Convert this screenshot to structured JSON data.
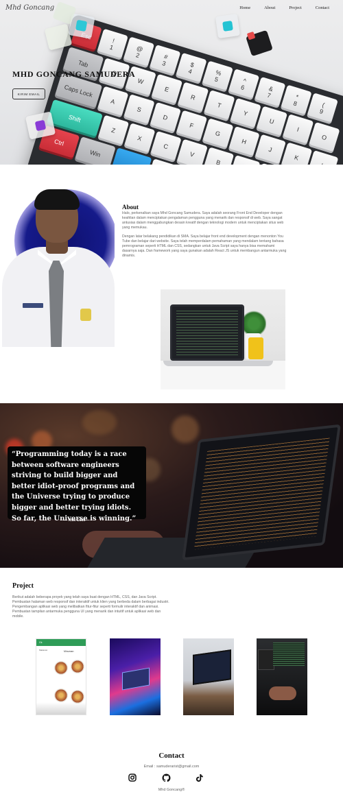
{
  "header": {
    "brand": "Mhd Goncang",
    "nav": [
      "Home",
      "About",
      "Project",
      "Contact"
    ]
  },
  "hero": {
    "title": "MHD GONCANG SAMUDERA",
    "button_label": "KIRIM EMAIL"
  },
  "keyboard": {
    "rows": [
      [
        {
          "t": "Esc",
          "c": "red"
        },
        {
          "t": "!",
          "s": "1"
        },
        {
          "t": "@",
          "s": "2"
        },
        {
          "t": "#",
          "s": "3"
        },
        {
          "t": "$",
          "s": "4"
        },
        {
          "t": "%",
          "s": "5"
        },
        {
          "t": "^",
          "s": "6"
        },
        {
          "t": "&",
          "s": "7"
        },
        {
          "t": "*",
          "s": "8"
        },
        {
          "t": "(",
          "s": "9"
        }
      ],
      [
        {
          "t": "Tab",
          "c": "gray",
          "w": "w18"
        },
        {
          "t": "Q"
        },
        {
          "t": "W"
        },
        {
          "t": "E"
        },
        {
          "t": "R"
        },
        {
          "t": "T"
        },
        {
          "t": "Y"
        },
        {
          "t": "U"
        },
        {
          "t": "I"
        },
        {
          "t": "O"
        }
      ],
      [
        {
          "t": "Caps Lock",
          "c": "gray",
          "w": "w2"
        },
        {
          "t": "A"
        },
        {
          "t": "S"
        },
        {
          "t": "D"
        },
        {
          "t": "F"
        },
        {
          "t": "G"
        },
        {
          "t": "H"
        },
        {
          "t": "J"
        },
        {
          "t": "K"
        },
        {
          "t": "L"
        }
      ],
      [
        {
          "t": "Shift",
          "c": "teal",
          "w": "w25"
        },
        {
          "t": "Z"
        },
        {
          "t": "X"
        },
        {
          "t": "C"
        },
        {
          "t": "V"
        },
        {
          "t": "B"
        },
        {
          "t": "N"
        },
        {
          "t": "M"
        },
        {
          "t": "<"
        },
        {
          "t": ">"
        }
      ],
      [
        {
          "t": "Ctrl",
          "c": "red",
          "w": "w18"
        },
        {
          "t": "Win",
          "c": "gray",
          "w": "w18"
        },
        {
          "t": "",
          "c": "blue",
          "w": "w18"
        },
        {
          "t": ""
        },
        {
          "t": ""
        },
        {
          "t": ""
        },
        {
          "t": ""
        },
        {
          "t": ""
        }
      ]
    ]
  },
  "about": {
    "title": "About",
    "paragraph1": "Halo, perkenalkan saya Mhd Goncang Samudera. Saya adalah seorang Front End Developer dengan keahlian dalam menciptakan pengalaman pengguna yang menarik dan responsif di web. Saya sangat antusias dalam menggabungkan desain kreatif dengan teknologi modern untuk menciptakan situs web yang memukau.",
    "paragraph2": "Dengan latar belakang pendidikan di SMA. Saya belajar front end development dengan menonton You Tube dan belajar dari website. Saya telah memperdalam pemahaman yang mendalam tentang bahasa pemrograman seperti HTML dan CSS, sedangkan untuk Java Script saya hanya bisa memahami dasarnya saja. Dan framework yang saya gunakan adalah React JS untuk membangun antarmuka yang dinamis."
  },
  "quote": {
    "text": "“Programming today is a race between software engineers striving to build bigger and better idiot-proof programs and the Universe trying to produce bigger and better trying idiots. So far, the Universe is winning.”",
    "author": "— Rick Cook —"
  },
  "project": {
    "title": "Project",
    "text": "Berikut adalah beberapa proyek yang telah saya buat dengan HTML, CSS, dan Java Script. Pembuatan halaman web responsif dan interaktif untuk klien yang berbeda dalam berbagai industri. Pengembangan aplikasi web yang melibatkan fitur-fitur seperti formulir interaktif dan animasi. Pembuatan tampilan antarmuka pengguna UI yang menarik dan intuitif untuk aplikasi web dan mobile.",
    "card1": {
      "header": "Gk",
      "section_left": "Makanan",
      "section_right": "Minuman"
    }
  },
  "contact": {
    "title": "Contact",
    "email": "Email : samuderarist@gmail.com",
    "socials": [
      "instagram-icon",
      "github-icon",
      "tiktok-icon"
    ],
    "footer": "Mhd Goncang®"
  }
}
